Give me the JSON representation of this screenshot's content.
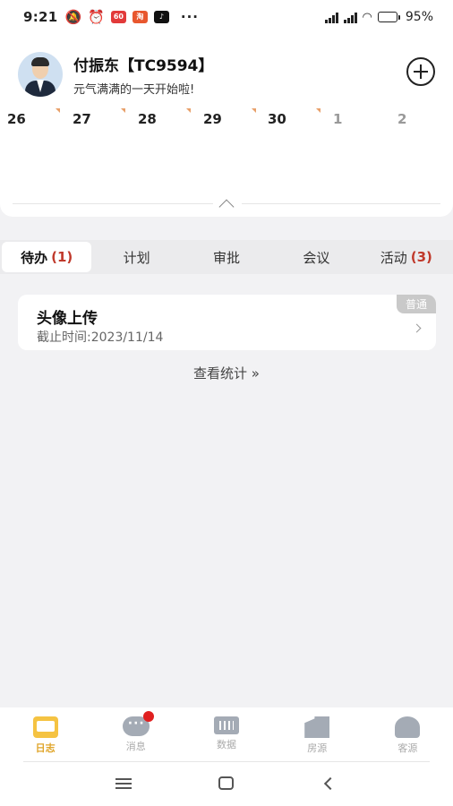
{
  "status_bar": {
    "time": "9:21",
    "battery": "95%",
    "battery_level": 0.95
  },
  "profile": {
    "name": "付振东【TC9594】",
    "greeting": "元气满满的一天开始啦!"
  },
  "calendar": {
    "days": [
      "26",
      "27",
      "28",
      "29",
      "30",
      "1",
      "2"
    ]
  },
  "tabs": [
    {
      "label": "待办",
      "count": "(1)"
    },
    {
      "label": "计划",
      "count": ""
    },
    {
      "label": "审批",
      "count": ""
    },
    {
      "label": "会议",
      "count": ""
    },
    {
      "label": "活动",
      "count": "(3)"
    }
  ],
  "task": {
    "title": "头像上传",
    "deadline": "截止时间:2023/11/14",
    "badge": "普通"
  },
  "stats_link": "查看统计 »",
  "bottom_nav": [
    {
      "label": "日志",
      "icon": "diary-icon"
    },
    {
      "label": "消息",
      "icon": "message-icon"
    },
    {
      "label": "数据",
      "icon": "data-icon"
    },
    {
      "label": "房源",
      "icon": "house-icon"
    },
    {
      "label": "客源",
      "icon": "client-icon"
    }
  ],
  "colors": {
    "accent": "#e0a52a",
    "count_red": "#c0392b",
    "notify": "#e02020"
  }
}
